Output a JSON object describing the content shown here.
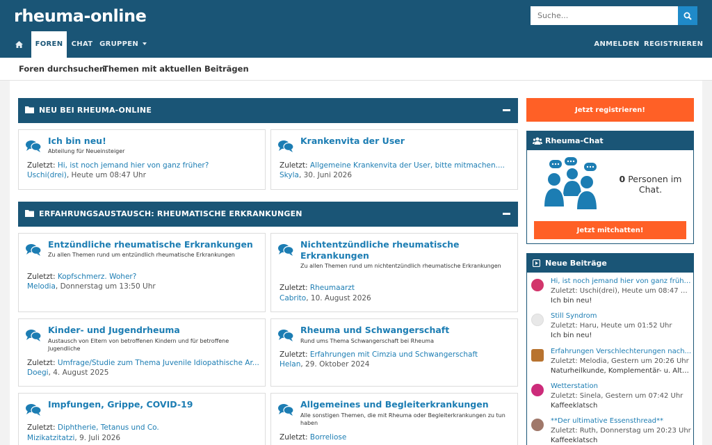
{
  "header": {
    "logo": "rheuma-online",
    "search_placeholder": "Suche...",
    "nav": {
      "foren": "FOREN",
      "chat": "CHAT",
      "gruppen": "GRUPPEN",
      "anmelden": "ANMELDEN",
      "registrieren": "REGISTRIEREN"
    }
  },
  "subnav": {
    "search_forums": "Foren durchsuchen",
    "recent_topics": "Themen mit aktuellen Beiträgen"
  },
  "sections": [
    {
      "title": "NEU BEI RHEUMA-ONLINE",
      "forums": [
        {
          "title": "Ich bin neu!",
          "desc": "Abteilung für Neueinsteiger",
          "last_label": "Zuletzt:",
          "last_topic": "Hi, ist noch jemand hier von ganz früher?",
          "user": "Uschi(drei)",
          "date": ", Heute um 08:47 Uhr"
        },
        {
          "title": "Krankenvita der User",
          "desc": "",
          "last_label": "Zuletzt:",
          "last_topic": "Allgemeine Krankenvita der User, bitte mitmachen....",
          "user": "Skyla",
          "date": ", 30. Juni 2026"
        }
      ]
    },
    {
      "title": "ERFAHRUNGSAUSTAUSCH: RHEUMATISCHE ERKRANKUNGEN",
      "forums": [
        {
          "title": "Entzündliche rheumatische Erkrankungen",
          "desc": "Zu allen Themen rund um entzündlich rheumatische Erkrankungen",
          "last_label": "Zuletzt:",
          "last_topic": "Kopfschmerz. Woher?",
          "user": "Melodia",
          "date": ", Donnerstag um 13:50 Uhr"
        },
        {
          "title": "Nichtentzündliche rheumatische Erkrankungen",
          "desc": "Zu allen Themen rund um nichtentzündlich rheumatische Erkrankungen",
          "last_label": "Zuletzt:",
          "last_topic": "Rheumaarzt",
          "user": "Cabrito",
          "date": ", 10. August 2026"
        },
        {
          "title": "Kinder- und Jugendrheuma",
          "desc": "Austausch von Eltern von betroffenen Kindern und für betroffene Jugendliche",
          "last_label": "Zuletzt:",
          "last_topic": "Umfrage/Studie zum Thema Juvenile Idiopathische Ar...",
          "user": "Doegi",
          "date": ", 4. August 2025"
        },
        {
          "title": "Rheuma und Schwangerschaft",
          "desc": "Rund ums Thema Schwangerschaft bei Rheuma",
          "last_label": "Zuletzt:",
          "last_topic": "Erfahrungen mit Cimzia und Schwangerschaft",
          "user": "Helan",
          "date": ", 29. Oktober 2024"
        },
        {
          "title": "Impfungen, Grippe, COVID-19",
          "desc": "",
          "last_label": "Zuletzt:",
          "last_topic": "Diphtherie, Tetanus und Co.",
          "user": "Mizikatzitatzi",
          "date": ", 9. Juli 2026"
        },
        {
          "title": "Allgemeines und Begleiterkrankungen",
          "desc": "Alle sonstigen Themen, die mit Rheuma oder Begleiterkrankungen zu tun haben",
          "last_label": "Zuletzt:",
          "last_topic": "Borreliose",
          "user": "",
          "date": ""
        }
      ]
    }
  ],
  "sidebar": {
    "register_button": "Jetzt registrieren!",
    "chat": {
      "title": "Rheuma-Chat",
      "count": "0",
      "count_text": "Personen im Chat.",
      "button": "Jetzt mitchatten!"
    },
    "new_posts": {
      "title": "Neue Beiträge",
      "items": [
        {
          "title": "Hi, ist noch jemand hier von ganz früher?",
          "meta": "Zuletzt: Uschi(drei), Heute um 08:47 Uhr",
          "forum": "Ich bin neu!",
          "avatar_color": "#d2356b"
        },
        {
          "title": "Still Syndrom",
          "meta": "Zuletzt: Haru, Heute um 01:52 Uhr",
          "forum": "Ich bin neu!",
          "avatar_color": "#e8e8e8"
        },
        {
          "title": "Erfahrungen Verschlechterungen nach...",
          "meta": "Zuletzt: Melodia, Gestern um 20:26 Uhr",
          "forum": "Naturheilkunde, Komplementär- u. Alte...",
          "avatar_color": "#b8732f"
        },
        {
          "title": "Wetterstation",
          "meta": "Zuletzt: Sinela, Gestern um 07:42 Uhr",
          "forum": "Kaffeeklatsch",
          "avatar_color": "#cc2b7a"
        },
        {
          "title": "**Der ultimative Essensthread**",
          "meta": "Zuletzt: Ruth, Donnerstag um 20:23 Uhr",
          "forum": "Kaffeeklatsch",
          "avatar_color": "#a0786a"
        }
      ]
    }
  },
  "colors": {
    "primary": "#1a5576",
    "link": "#1c7db3",
    "accent": "#ff6026",
    "search_button": "#1f8ac9"
  }
}
